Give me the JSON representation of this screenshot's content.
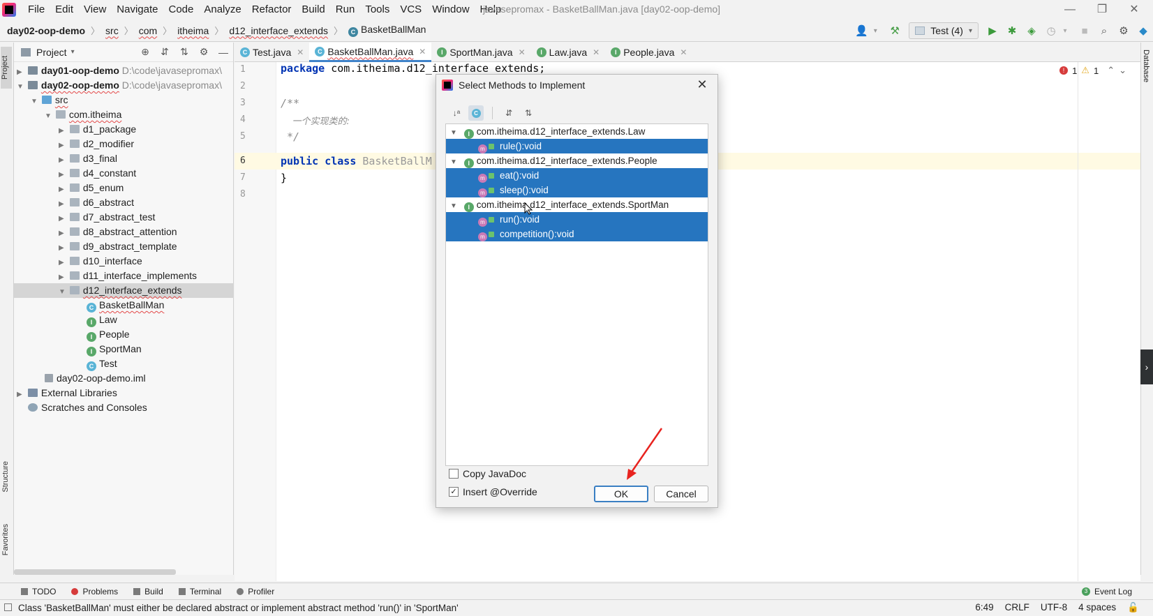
{
  "menubar": {
    "items": [
      "File",
      "Edit",
      "View",
      "Navigate",
      "Code",
      "Analyze",
      "Refactor",
      "Build",
      "Run",
      "Tools",
      "VCS",
      "Window",
      "Help"
    ],
    "window_title": "javasepromax - BasketBallMan.java [day02-oop-demo]"
  },
  "navbar": {
    "breadcrumbs": [
      "day02-oop-demo",
      "src",
      "com",
      "itheima",
      "d12_interface_extends",
      "BasketBallMan"
    ],
    "run_config": "Test (4)"
  },
  "left_strip": {
    "project_tab": "Project",
    "structure_tab": "Structure",
    "favorites_tab": "Favorites"
  },
  "right_strip": {
    "database_tab": "Database"
  },
  "project_panel": {
    "title": "Project",
    "tree": [
      {
        "label": "day01-oop-demo",
        "path": "D:\\code\\javasepromax\\"
      },
      {
        "label": "day02-oop-demo",
        "path": "D:\\code\\javasepromax\\"
      },
      {
        "label": "src"
      },
      {
        "label": "com.itheima"
      },
      {
        "label": "d1_package"
      },
      {
        "label": "d2_modifier"
      },
      {
        "label": "d3_final"
      },
      {
        "label": "d4_constant"
      },
      {
        "label": "d5_enum"
      },
      {
        "label": "d6_abstract"
      },
      {
        "label": "d7_abstract_test"
      },
      {
        "label": "d8_abstract_attention"
      },
      {
        "label": "d9_abstract_template"
      },
      {
        "label": "d10_interface"
      },
      {
        "label": "d11_interface_implements"
      },
      {
        "label": "d12_interface_extends"
      },
      {
        "label": "BasketBallMan"
      },
      {
        "label": "Law"
      },
      {
        "label": "People"
      },
      {
        "label": "SportMan"
      },
      {
        "label": "Test"
      },
      {
        "label": "day02-oop-demo.iml"
      },
      {
        "label": "External Libraries"
      },
      {
        "label": "Scratches and Consoles"
      }
    ]
  },
  "editor_tabs": [
    "Test.java",
    "BasketBallMan.java",
    "SportMan.java",
    "Law.java",
    "People.java"
  ],
  "editor": {
    "line_numbers": [
      "1",
      "2",
      "3",
      "4",
      "5",
      "6",
      "7",
      "8"
    ],
    "lines": {
      "l1_kw": "package",
      "l1_rest": " com.itheima.d12_interface_extends;",
      "l3": "/**",
      "l4": "    一个实现类的:",
      "l5": " */",
      "l6_kw": "public class",
      "l6_rest": " BasketBallM",
      "l7": "}"
    },
    "errors": "1",
    "warnings": "1"
  },
  "dialog": {
    "title": "Select Methods to Implement",
    "groups": [
      {
        "name": "com.itheima.d12_interface_extends.Law",
        "methods": [
          "rule():void"
        ]
      },
      {
        "name": "com.itheima.d12_interface_extends.People",
        "methods": [
          "eat():void",
          "sleep():void"
        ]
      },
      {
        "name": "com.itheima.d12_interface_extends.SportMan",
        "methods": [
          "run():void",
          "competition():void"
        ]
      }
    ],
    "copy_javadoc_label": "Copy JavaDoc",
    "copy_javadoc_checked": false,
    "insert_override_label": "Insert @Override",
    "insert_override_checked": true,
    "ok_label": "OK",
    "cancel_label": "Cancel"
  },
  "bottom_tools": [
    "TODO",
    "Problems",
    "Build",
    "Terminal",
    "Profiler"
  ],
  "event_log": "Event Log",
  "statusbar": {
    "message": "Class 'BasketBallMan' must either be declared abstract or implement abstract method 'run()' in 'SportMan'",
    "position": "6:49",
    "line_sep": "CRLF",
    "encoding": "UTF-8",
    "indent": "4 spaces"
  }
}
